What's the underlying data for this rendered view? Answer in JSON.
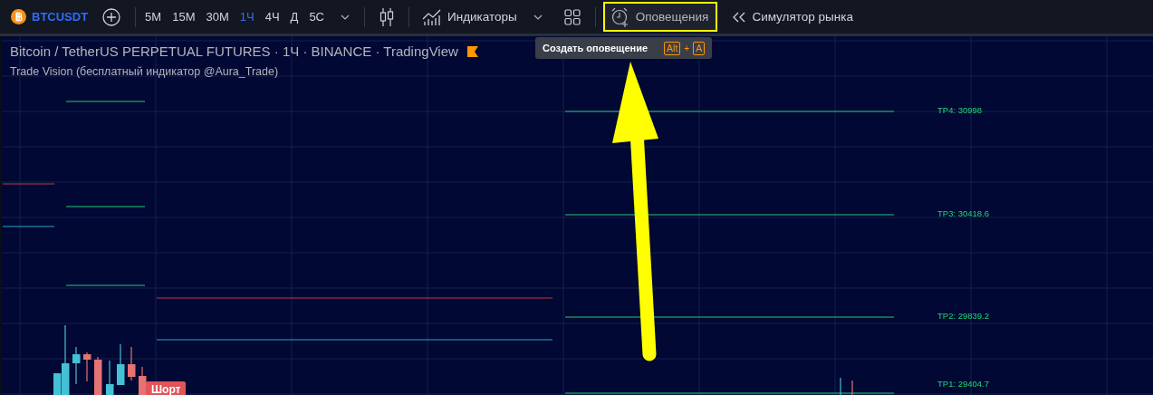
{
  "toolbar": {
    "symbol": "BTCUSDT",
    "intervals": [
      {
        "label": "5M",
        "selected": false
      },
      {
        "label": "15M",
        "selected": false
      },
      {
        "label": "30M",
        "selected": false
      },
      {
        "label": "1Ч",
        "selected": true
      },
      {
        "label": "4Ч",
        "selected": false
      },
      {
        "label": "Д",
        "selected": false
      },
      {
        "label": "5С",
        "selected": false
      }
    ],
    "indicators_button": "Индикаторы",
    "alerts_button": {
      "label": "Оповещения",
      "highlighted": true
    },
    "replay_button": "Симулятор рынка"
  },
  "tooltip": {
    "text": "Создать оповещение",
    "keys": [
      "Alt",
      "A"
    ],
    "joiner": "+"
  },
  "chart": {
    "title": "Bitcoin / TetherUS PERPETUAL FUTURES · 1Ч · BINANCE · TradingView",
    "indicator": "Trade Vision (бесплатный индикатор @Aura_Trade)",
    "targets": [
      "TP4: 30998",
      "TP3: 30418.6",
      "TP2: 29839.2",
      "TP1: 29404.7"
    ],
    "signal": "Шорт"
  }
}
